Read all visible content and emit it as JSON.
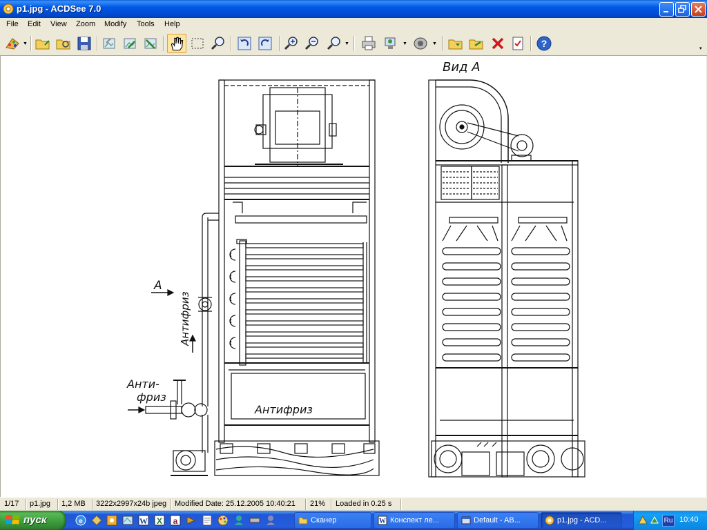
{
  "window": {
    "title": "p1.jpg - ACDSee 7.0"
  },
  "menu": [
    "File",
    "Edit",
    "View",
    "Zoom",
    "Modify",
    "Tools",
    "Help"
  ],
  "toolbar": {
    "icons": [
      "acquire-icon",
      "browse-icon",
      "open-icon",
      "save-icon",
      "previous-icon",
      "next-icon",
      "slideshow-icon",
      "hand-tool-icon",
      "select-tool-icon",
      "zoom-tool-icon",
      "rotate-left-icon",
      "rotate-right-icon",
      "zoom-in-icon",
      "zoom-out-icon",
      "zoom-icon",
      "print-icon",
      "wallpaper-icon",
      "audio-icon",
      "copy-to-icon",
      "move-to-icon",
      "delete-icon",
      "properties-icon",
      "help-icon"
    ]
  },
  "drawing": {
    "view_label": "Вид А",
    "arrow_label": "А",
    "antifreeze_vertical": "Антифриз",
    "antifreeze_inlet_line1": "Анти-",
    "antifreeze_inlet_line2": "фриз",
    "tank_label": "Антифриз"
  },
  "status": {
    "index": "1/17",
    "filename": "p1.jpg",
    "filesize": "1,2 MB",
    "dimensions": "3222x2997x24b jpeg",
    "modified": "Modified Date: 25.12.2005 10:40:21",
    "zoom": "21%",
    "loaded": "Loaded in 0.25 s"
  },
  "taskbar": {
    "start_label": "пуск",
    "tasks": [
      {
        "label": "Сканер",
        "icon": "folder-icon"
      },
      {
        "label": "Конспект ле...",
        "icon": "word-icon"
      },
      {
        "label": "Default - AB...",
        "icon": "app-icon"
      },
      {
        "label": "p1.jpg - ACD...",
        "icon": "acdsee-icon"
      }
    ],
    "language": "Ru",
    "clock": "10:40"
  },
  "colors": {
    "titlebar": "#0054e3",
    "taskbar": "#245ddb",
    "start": "#3a9b3a",
    "drawing_ink": "#111111"
  }
}
